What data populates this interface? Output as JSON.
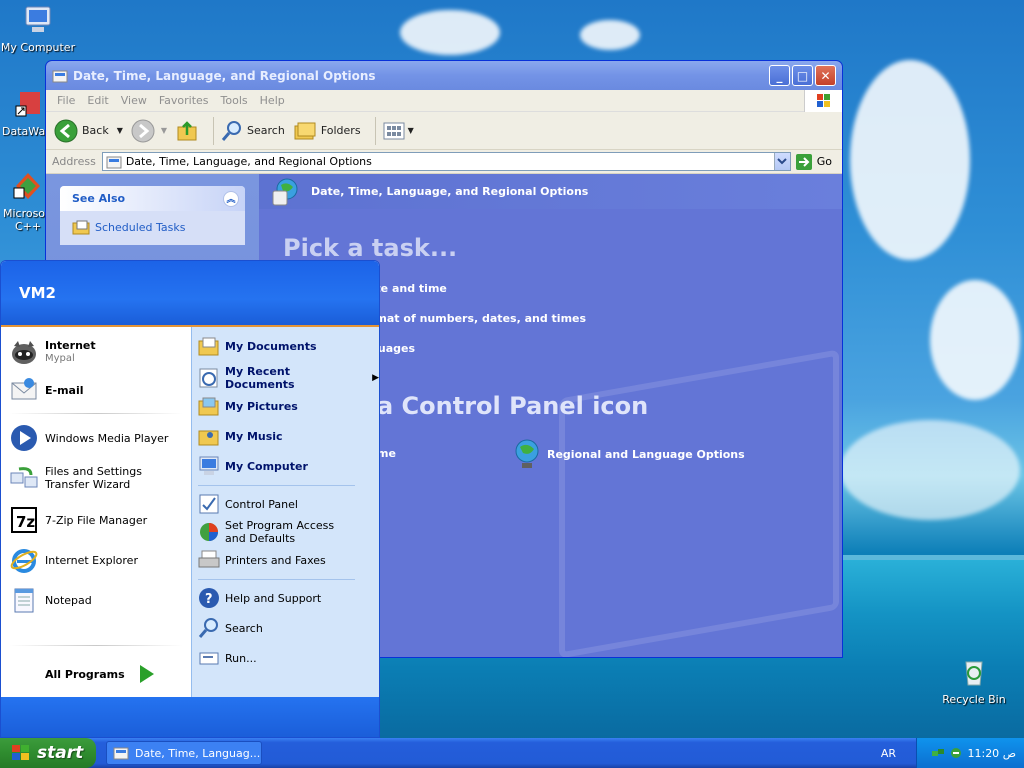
{
  "desktop": {
    "icons": [
      {
        "label": "My Computer"
      },
      {
        "label": "DataWar"
      },
      {
        "label": "Microsoft C++"
      },
      {
        "label": "Recycle Bin"
      }
    ]
  },
  "window": {
    "title": "Date, Time, Language, and Regional Options",
    "menu": [
      "File",
      "Edit",
      "View",
      "Favorites",
      "Tools",
      "Help"
    ],
    "toolbar": {
      "back": "Back",
      "search": "Search",
      "folders": "Folders"
    },
    "address": {
      "label": "Address",
      "value": "Date, Time, Language, and Regional Options",
      "go": "Go"
    },
    "task_pane": {
      "see_also": "See Also",
      "links": [
        "Scheduled Tasks"
      ]
    },
    "main": {
      "header": "Date, Time, Language, and Regional Options",
      "pick_task": "Pick a task...",
      "tasks": [
        "ate and time",
        "rmat of numbers, dates, and times",
        "guages"
      ],
      "pick_icon": "a Control Panel icon",
      "icons": [
        "me",
        "Regional and Language Options"
      ]
    }
  },
  "start_menu": {
    "user": "VM2",
    "pinned": [
      {
        "label": "Internet",
        "sub": "Mypal"
      },
      {
        "label": "E-mail",
        "sub": ""
      }
    ],
    "recent": [
      "Windows Media Player",
      "Files and Settings Transfer Wizard",
      "7-Zip File Manager",
      "Internet Explorer",
      "Notepad"
    ],
    "all_programs": "All Programs",
    "right": {
      "places": [
        "My Documents",
        "My Recent Documents",
        "My Pictures",
        "My Music",
        "My Computer"
      ],
      "settings": [
        "Control Panel",
        "Set Program Access and Defaults",
        "Printers and Faxes"
      ],
      "help": [
        "Help and Support",
        "Search",
        "Run..."
      ]
    }
  },
  "taskbar": {
    "start": "start",
    "task": "Date, Time, Languag...",
    "language": "AR",
    "clock": "11:20 ص"
  }
}
